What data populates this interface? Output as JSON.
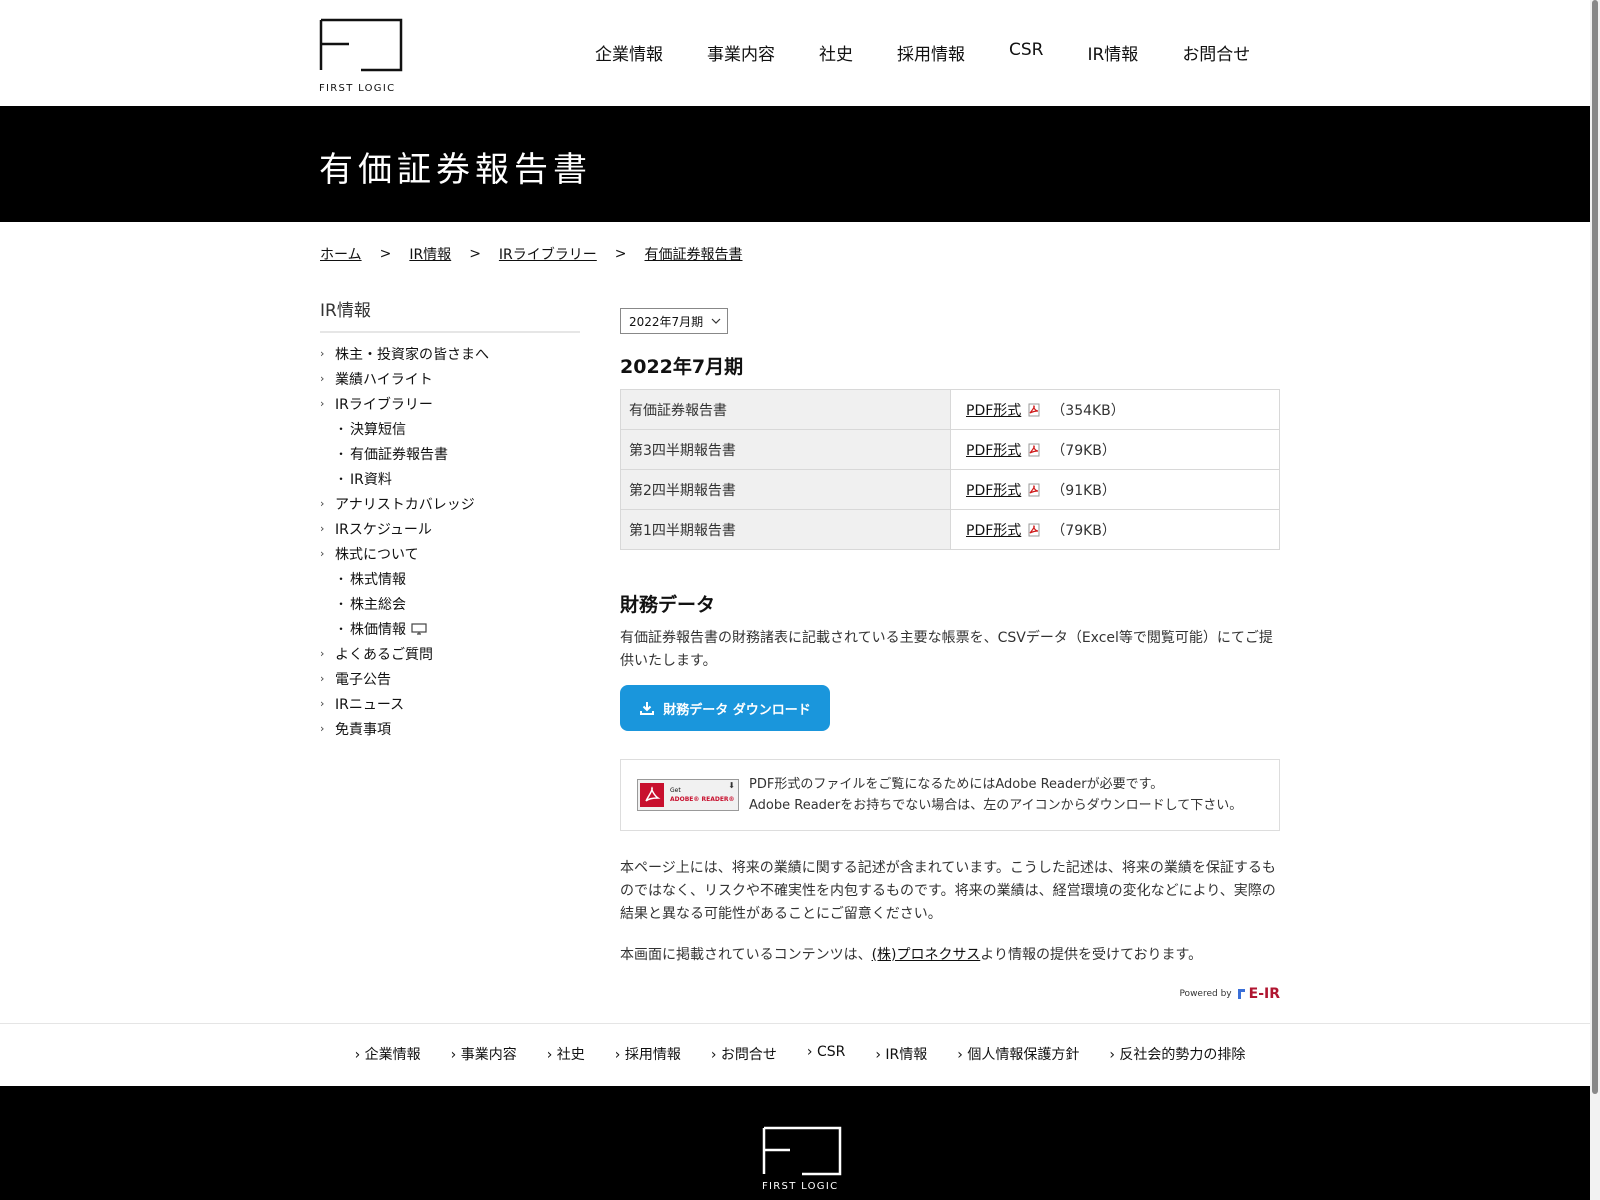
{
  "header": {
    "logo_text": "FIRST LOGIC",
    "nav": [
      "企業情報",
      "事業内容",
      "社史",
      "採用情報",
      "CSR",
      "IR情報",
      "お問合せ"
    ]
  },
  "page_title": "有価証券報告書",
  "breadcrumb": [
    "ホーム",
    "IR情報",
    "IRライブラリー",
    "有価証券報告書"
  ],
  "breadcrumb_sep": ">",
  "sidebar": {
    "title": "IR情報",
    "items": [
      {
        "label": "株主・投資家の皆さまへ",
        "level": 1
      },
      {
        "label": "業績ハイライト",
        "level": 1
      },
      {
        "label": "IRライブラリー",
        "level": 1
      },
      {
        "label": "決算短信",
        "level": 2
      },
      {
        "label": "有価証券報告書",
        "level": 2
      },
      {
        "label": "IR資料",
        "level": 2
      },
      {
        "label": "アナリストカバレッジ",
        "level": 1
      },
      {
        "label": "IRスケジュール",
        "level": 1
      },
      {
        "label": "株式について",
        "level": 1
      },
      {
        "label": "株式情報",
        "level": 2
      },
      {
        "label": "株主総会",
        "level": 2
      },
      {
        "label": "株価情報",
        "level": 2,
        "icon": "monitor-icon"
      },
      {
        "label": "よくあるご質問",
        "level": 1
      },
      {
        "label": "電子公告",
        "level": 1
      },
      {
        "label": "IRニュース",
        "level": 1
      },
      {
        "label": "免責事項",
        "level": 1
      }
    ]
  },
  "period_select": {
    "value": "2022年7月期"
  },
  "period_heading": "2022年7月期",
  "reports": [
    {
      "name": "有価証券報告書",
      "link": "PDF形式",
      "size": "（354KB）"
    },
    {
      "name": "第3四半期報告書",
      "link": "PDF形式",
      "size": "（79KB）"
    },
    {
      "name": "第2四半期報告書",
      "link": "PDF形式",
      "size": "（91KB）"
    },
    {
      "name": "第1四半期報告書",
      "link": "PDF形式",
      "size": "（79KB）"
    }
  ],
  "financial": {
    "heading": "財務データ",
    "text": "有価証券報告書の財務諸表に記載されている主要な帳票を、CSVデータ（Excel等で閲覧可能）にてご提供いたします。",
    "button_label": "財務データ ダウンロード"
  },
  "adobe": {
    "badge_get": "Get",
    "badge_name": "ADOBE® READER®",
    "line1": "PDF形式のファイルをご覧になるためにはAdobe Readerが必要です。",
    "line2": "Adobe Readerをお持ちでない場合は、左のアイコンからダウンロードして下さい。"
  },
  "disclaimer": "本ページ上には、将来の業績に関する記述が含まれています。こうした記述は、将来の業績を保証するものではなく、リスクや不確実性を内包するものです。将来の業績は、経営環境の変化などにより、実際の結果と異なる可能性があることにご留意ください。",
  "provider": {
    "before": "本画面に掲載されているコンテンツは、",
    "link": "(株)プロネクサス",
    "after": "より情報の提供を受けております。"
  },
  "powered": {
    "label": "Powered by",
    "brand": "E-IR"
  },
  "footer": {
    "nav": [
      "企業情報",
      "事業内容",
      "社史",
      "採用情報",
      "お問合せ",
      "CSR",
      "IR情報",
      "個人情報保護方針",
      "反社会的勢力の排除"
    ],
    "logo_text": "FIRST LOGIC"
  },
  "colors": {
    "accent": "#1a96dc",
    "band": "#000000",
    "adobe_red": "#c8102e",
    "eir_red": "#b01530"
  }
}
